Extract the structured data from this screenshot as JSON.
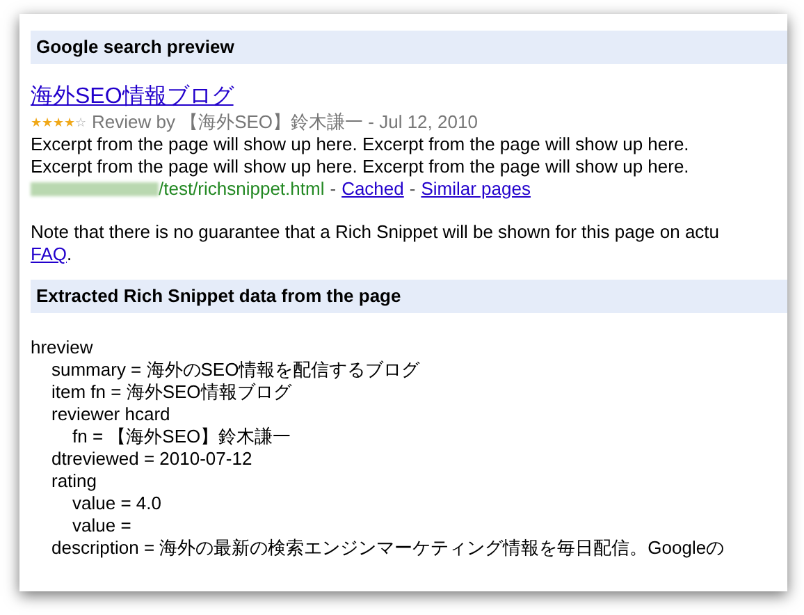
{
  "preview": {
    "heading": "Google search preview",
    "result": {
      "title": "海外SEO情報ブログ",
      "stars": 4,
      "byline": "Review by 【海外SEO】鈴木謙一 - Jul 12, 2010",
      "excerpt": [
        "Excerpt from the page will show up here. Excerpt from the page will show up here.",
        "Excerpt from the page will show up here. Excerpt from the page will show up here."
      ],
      "url": "/test/richsnippet.html",
      "links": [
        {
          "separator": "-",
          "label": "Cached"
        },
        {
          "separator": "-",
          "label": "Similar pages"
        }
      ]
    },
    "note": "Note that there is no guarantee that a Rich Snippet will be shown for this page on actu",
    "note_link": "FAQ",
    "note_end": "."
  },
  "extracted": {
    "heading": "Extracted Rich Snippet data from the page",
    "tree": [
      {
        "text": "hreview",
        "children": [
          {
            "text": "summary = 海外のSEO情報を配信するブログ"
          },
          {
            "text": "item fn = 海外SEO情報ブログ"
          },
          {
            "text": "reviewer hcard",
            "children": [
              {
                "text": "fn = 【海外SEO】鈴木謙一"
              }
            ]
          },
          {
            "text": "dtreviewed = 2010-07-12"
          },
          {
            "text": "rating",
            "children": [
              {
                "text": "value = 4.0"
              },
              {
                "text": "value ="
              }
            ]
          },
          {
            "text": "description = 海外の最新の検索エンジンマーケティング情報を毎日配信。Googleの"
          }
        ]
      }
    ]
  }
}
